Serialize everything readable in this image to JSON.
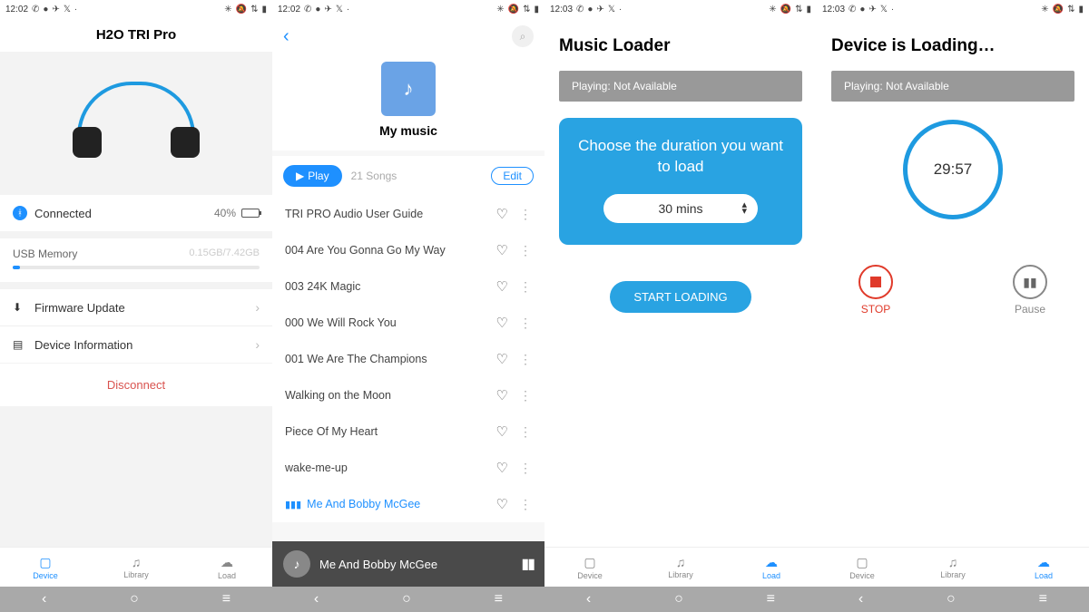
{
  "status": {
    "t1": "12:02",
    "t2": "12:02",
    "t3": "12:03",
    "t4": "12:03",
    "left_icons": [
      "whatsapp",
      "messenger",
      "telegram",
      "twitter",
      "dot"
    ],
    "right_icons": [
      "vibrate",
      "mute",
      "wifi",
      "battery"
    ]
  },
  "tabs": {
    "device": "Device",
    "library": "Library",
    "load": "Load"
  },
  "screen1": {
    "title": "H2O TRI Pro",
    "connected": "Connected",
    "battery_pct": "40%",
    "usb_label": "USB Memory",
    "usb_value": "0.15GB/7.42GB",
    "fw": "Firmware Update",
    "info": "Device Information",
    "disconnect": "Disconnect"
  },
  "screen2": {
    "header": "My music",
    "play": "Play",
    "count": "21 Songs",
    "edit": "Edit",
    "songs": [
      "TRI PRO Audio User Guide",
      "004 Are You Gonna Go My Way",
      "003 24K Magic",
      "000 We Will Rock You",
      "001 We Are The Champions",
      "Walking on the Moon",
      "Piece Of My Heart",
      "wake-me-up",
      "Me And Bobby McGee"
    ],
    "now_playing": "Me And Bobby McGee"
  },
  "screen3": {
    "title": "Music Loader",
    "banner": "Playing: Not Available",
    "card_text": "Choose the duration you want to load",
    "duration": "30 mins",
    "start": "START LOADING"
  },
  "screen4": {
    "title": "Device is Loading…",
    "banner": "Playing: Not Available",
    "time": "29:57",
    "stop": "STOP",
    "pause": "Pause"
  }
}
